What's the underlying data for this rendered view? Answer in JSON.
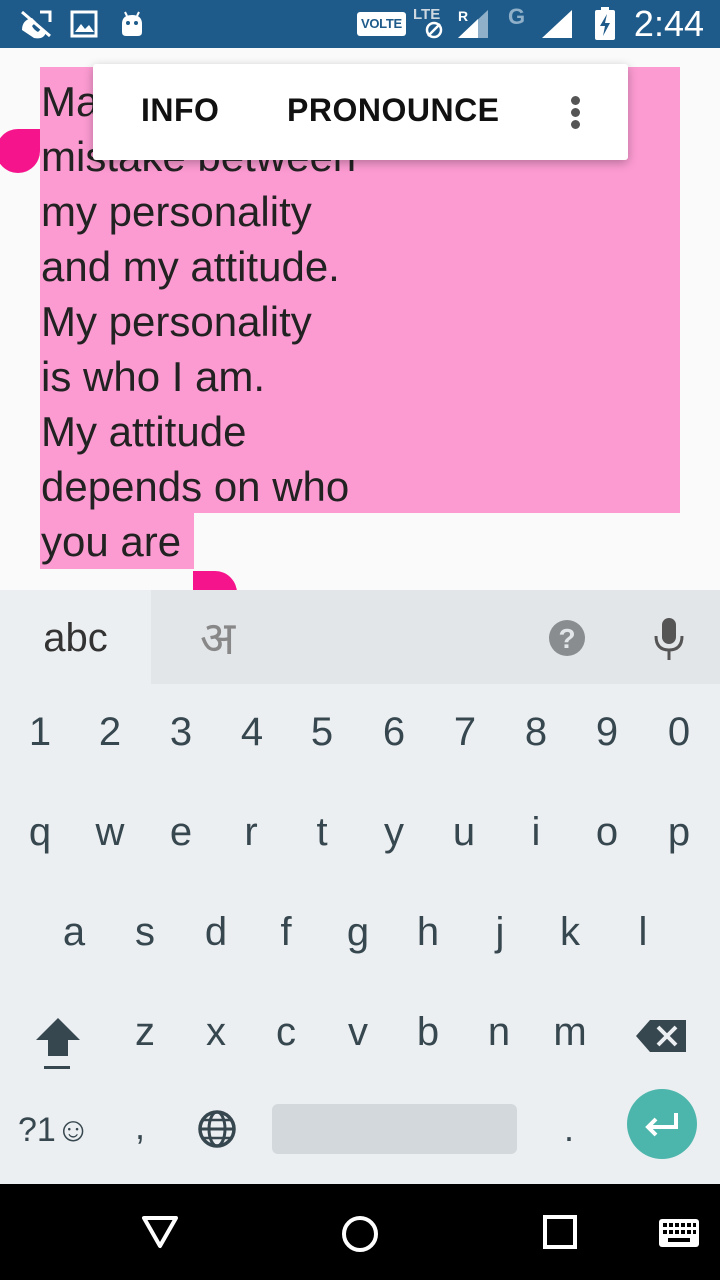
{
  "status_bar": {
    "volte": "VOLTE",
    "lte": "LTE",
    "roaming": "R",
    "network_g": "G",
    "time": "2:44",
    "icons": [
      "missed-call-icon",
      "gallery-icon",
      "android-icon",
      "volte-badge",
      "lte-signal-icon",
      "signal-icon",
      "battery-charging-icon"
    ]
  },
  "note": {
    "text": "Ma\nmistake between\nmy personality\nand my attitude.\nMy personality\nis who I am.\nMy attitude\ndepends on who\nyou are",
    "selection_color": "#fc9bd2",
    "handle_color": "#f5148c"
  },
  "toolbar": {
    "info_label": "INFO",
    "pronounce_label": "PRONOUNCE",
    "more_icon": "more-vert-icon"
  },
  "keyboard": {
    "abc_label": "abc",
    "hindi_label": "अ",
    "help_icon": "?",
    "number_row": [
      "1",
      "2",
      "3",
      "4",
      "5",
      "6",
      "7",
      "8",
      "9",
      "0"
    ],
    "row1": [
      "q",
      "w",
      "e",
      "r",
      "t",
      "y",
      "u",
      "i",
      "o",
      "p"
    ],
    "row2": [
      "a",
      "s",
      "d",
      "f",
      "g",
      "h",
      "j",
      "k",
      "l"
    ],
    "row3": [
      "z",
      "x",
      "c",
      "v",
      "b",
      "n",
      "m"
    ],
    "symbols_label": "?1☺",
    "comma": ",",
    "period": ".",
    "enter_color": "#4db6ac"
  },
  "nav_bar": {
    "icons": [
      "back-icon",
      "home-icon",
      "recents-icon",
      "keyboard-switch-icon"
    ]
  }
}
